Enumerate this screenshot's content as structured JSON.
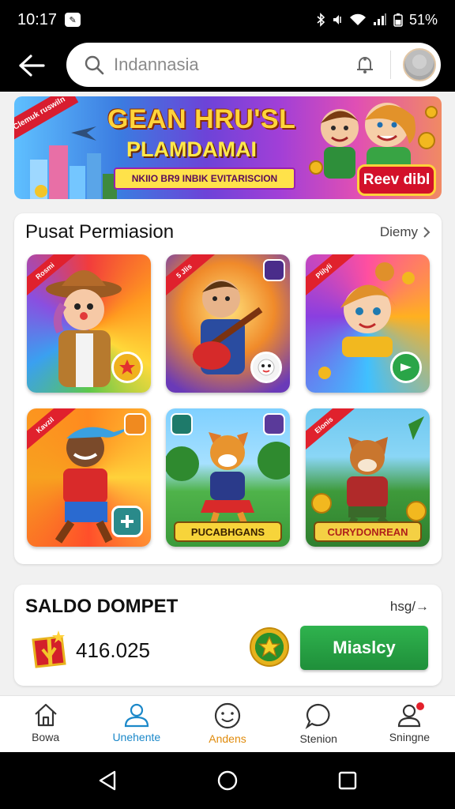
{
  "status_bar": {
    "time": "10:17",
    "battery": "51%"
  },
  "search": {
    "placeholder": "Indannasia"
  },
  "banner": {
    "ribbon": "Clemuk ruswiln",
    "title": "GEAN HRU'SL",
    "subtitle": "PLAMDAMAI",
    "strip_text": "NKIIO BR9 INBIK EVITARISCION",
    "button": "Reev dibl"
  },
  "promo": {
    "title": "Pusat Permiasion",
    "more": "Diemy",
    "tiles": [
      {
        "ribbon": "Rosmi"
      },
      {
        "ribbon": "5 Jlis"
      },
      {
        "ribbon": "Plilyli"
      },
      {
        "ribbon": "Kavzil"
      },
      {
        "ribbon": "",
        "label": "PUCABHGANS"
      },
      {
        "ribbon": "Elonis",
        "label": "CURYDONREAN"
      }
    ]
  },
  "wallet": {
    "title": "SALDO DOMPET",
    "link": "hsg/→",
    "amount": "416.025",
    "button": "Miaslcy"
  },
  "bottom_nav": [
    {
      "label": "Bowa",
      "icon": "home-icon"
    },
    {
      "label": "Unehente",
      "icon": "user-icon"
    },
    {
      "label": "Andens",
      "icon": "smile-icon"
    },
    {
      "label": "Stenion",
      "icon": "chat-icon"
    },
    {
      "label": "Sningne",
      "icon": "profile-icon"
    }
  ],
  "colors": {
    "accent_blue": "#1b88c9",
    "accent_orange": "#e08b0c",
    "cta_green": "#2fb34e",
    "banner_red": "#d3112a"
  }
}
